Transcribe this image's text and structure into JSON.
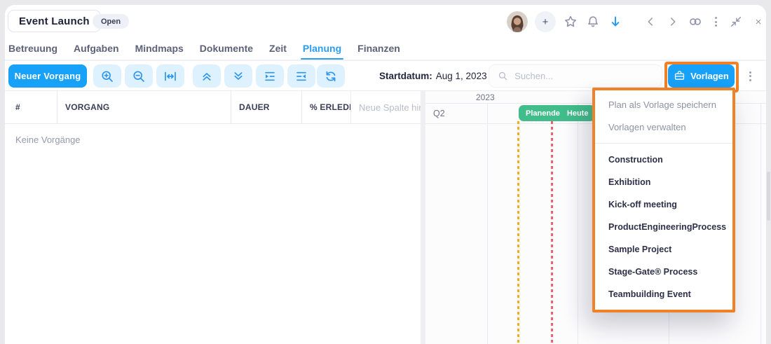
{
  "window": {
    "title": "Event Launch",
    "status": "Open"
  },
  "tabs": [
    {
      "label": "Betreuung"
    },
    {
      "label": "Aufgaben"
    },
    {
      "label": "Mindmaps"
    },
    {
      "label": "Dokumente"
    },
    {
      "label": "Zeit"
    },
    {
      "label": "Planung"
    },
    {
      "label": "Finanzen"
    }
  ],
  "toolbar": {
    "new_task": "Neuer Vorgang",
    "start_date_label": "Startdatum:",
    "start_date_value": "Aug 1, 2023",
    "search_placeholder": "Suchen...",
    "templates_button": "Vorlagen"
  },
  "table": {
    "columns": {
      "number": "#",
      "task": "VORGANG",
      "duration": "DAUER",
      "percent_done": "% ERLEDI…",
      "new_column_placeholder": "Neue Spalte hir"
    },
    "empty_message": "Keine Vorgänge"
  },
  "timeline": {
    "year": "2023",
    "quarter": "Q2",
    "plan_end_label": "Planende",
    "today_label": "Heute"
  },
  "templates_menu": {
    "save_as_template": "Plan als Vorlage speichern",
    "manage_templates": "Vorlagen verwalten",
    "templates": [
      "Construction",
      "Exhibition",
      "Kick-off meeting",
      "ProductEngineeringProcess",
      "Sample Project",
      "Stage-Gate® Process",
      "Teambuilding Event"
    ]
  },
  "icons": {
    "plus": "+",
    "close": "×"
  },
  "colors": {
    "accent_blue": "#17a1f8",
    "active_tab_blue": "#2a9df4",
    "highlight_orange": "#ef8228",
    "badge_green": "#41bd8b",
    "plan_end_orange": "#fbab1e",
    "today_red": "#f2606b"
  }
}
